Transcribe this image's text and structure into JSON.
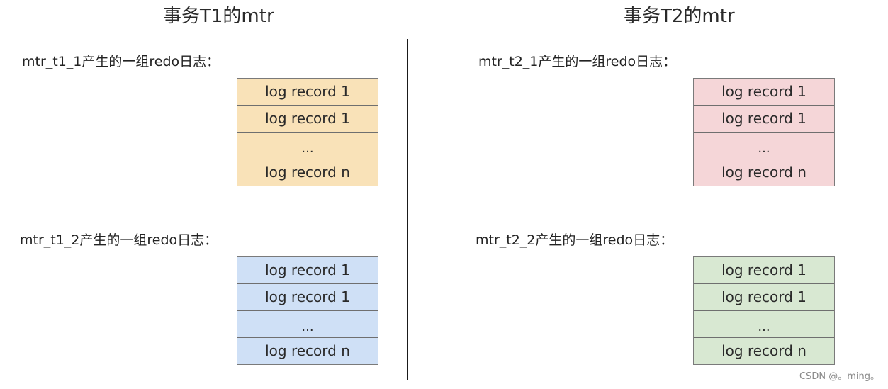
{
  "panels": [
    {
      "title": "事务T1的mtr",
      "groups": [
        {
          "label": "mtr_t1_1产生的一组redo日志：",
          "color": "#f9e2b8",
          "records": [
            "log record 1",
            "log record 1",
            "...",
            "log record n"
          ]
        },
        {
          "label": "mtr_t1_2产生的一组redo日志：",
          "color": "#cfe0f6",
          "records": [
            "log record 1",
            "log record 1",
            "...",
            "log record n"
          ]
        }
      ]
    },
    {
      "title": "事务T2的mtr",
      "groups": [
        {
          "label": "mtr_t2_1产生的一组redo日志：",
          "color": "#f5d6d8",
          "records": [
            "log record 1",
            "log record 1",
            "...",
            "log record n"
          ]
        },
        {
          "label": "mtr_t2_2产生的一组redo日志：",
          "color": "#d8e8d2",
          "records": [
            "log record 1",
            "log record 1",
            "...",
            "log record n"
          ]
        }
      ]
    }
  ],
  "watermark": "CSDN @。ming。"
}
